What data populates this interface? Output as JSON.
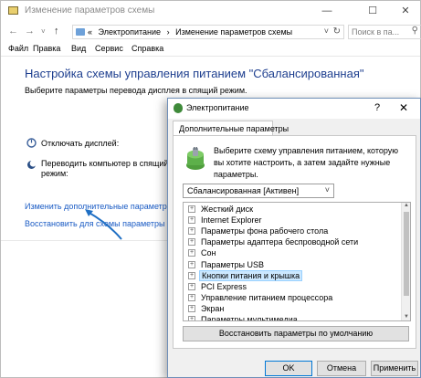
{
  "window": {
    "title": "Изменение параметров схемы",
    "minimize_icon": "minimize-icon",
    "maximize_icon": "maximize-icon",
    "close_icon": "close-icon"
  },
  "address_bar": {
    "crumbs": [
      "«",
      "Электропитание",
      "›",
      "Изменение параметров схемы"
    ],
    "search_placeholder": "Поиск в па..."
  },
  "menu": [
    "Файл",
    "Правка",
    "Вид",
    "Сервис",
    "Справка"
  ],
  "main": {
    "title": "Настройка схемы управления питанием \"Сбалансированная\"",
    "subtitle": "Выберите параметры перевода дисплея в спящий режим.",
    "display_off_label": "Отключать дисплей:",
    "sleep_label_1": "Переводить компьютер в спящий",
    "sleep_label_2": "режим:",
    "advanced_link": "Изменить дополнительные параметры",
    "restore_link": "Восстановить для схемы параметры по"
  },
  "dialog": {
    "title": "Электропитание",
    "help": "?",
    "close": "✕",
    "tab": "Дополнительные параметры",
    "description": "Выберите схему управления питанием, которую вы хотите настроить, а затем задайте нужные параметры.",
    "scheme_selected": "Сбалансированная [Активен]",
    "tree_items": [
      {
        "label": "Жесткий диск",
        "selected": false
      },
      {
        "label": "Internet Explorer",
        "selected": false
      },
      {
        "label": "Параметры фона рабочего стола",
        "selected": false
      },
      {
        "label": "Параметры адаптера беспроводной сети",
        "selected": false
      },
      {
        "label": "Сон",
        "selected": false
      },
      {
        "label": "Параметры USB",
        "selected": false
      },
      {
        "label": "Кнопки питания и крышка",
        "selected": true
      },
      {
        "label": "PCI Express",
        "selected": false
      },
      {
        "label": "Управление питанием процессора",
        "selected": false
      },
      {
        "label": "Экран",
        "selected": false
      },
      {
        "label": "Параметры мультимедиа",
        "selected": false
      }
    ],
    "restore_button": "Восстановить параметры по умолчанию",
    "ok_button": "OK",
    "cancel_button": "Отмена",
    "apply_button": "Применить"
  },
  "colors": {
    "title_blue": "#1e3f8f",
    "link_blue": "#1a5bc4",
    "selection": "#cce8ff",
    "arrow": "#1f6fc4"
  }
}
